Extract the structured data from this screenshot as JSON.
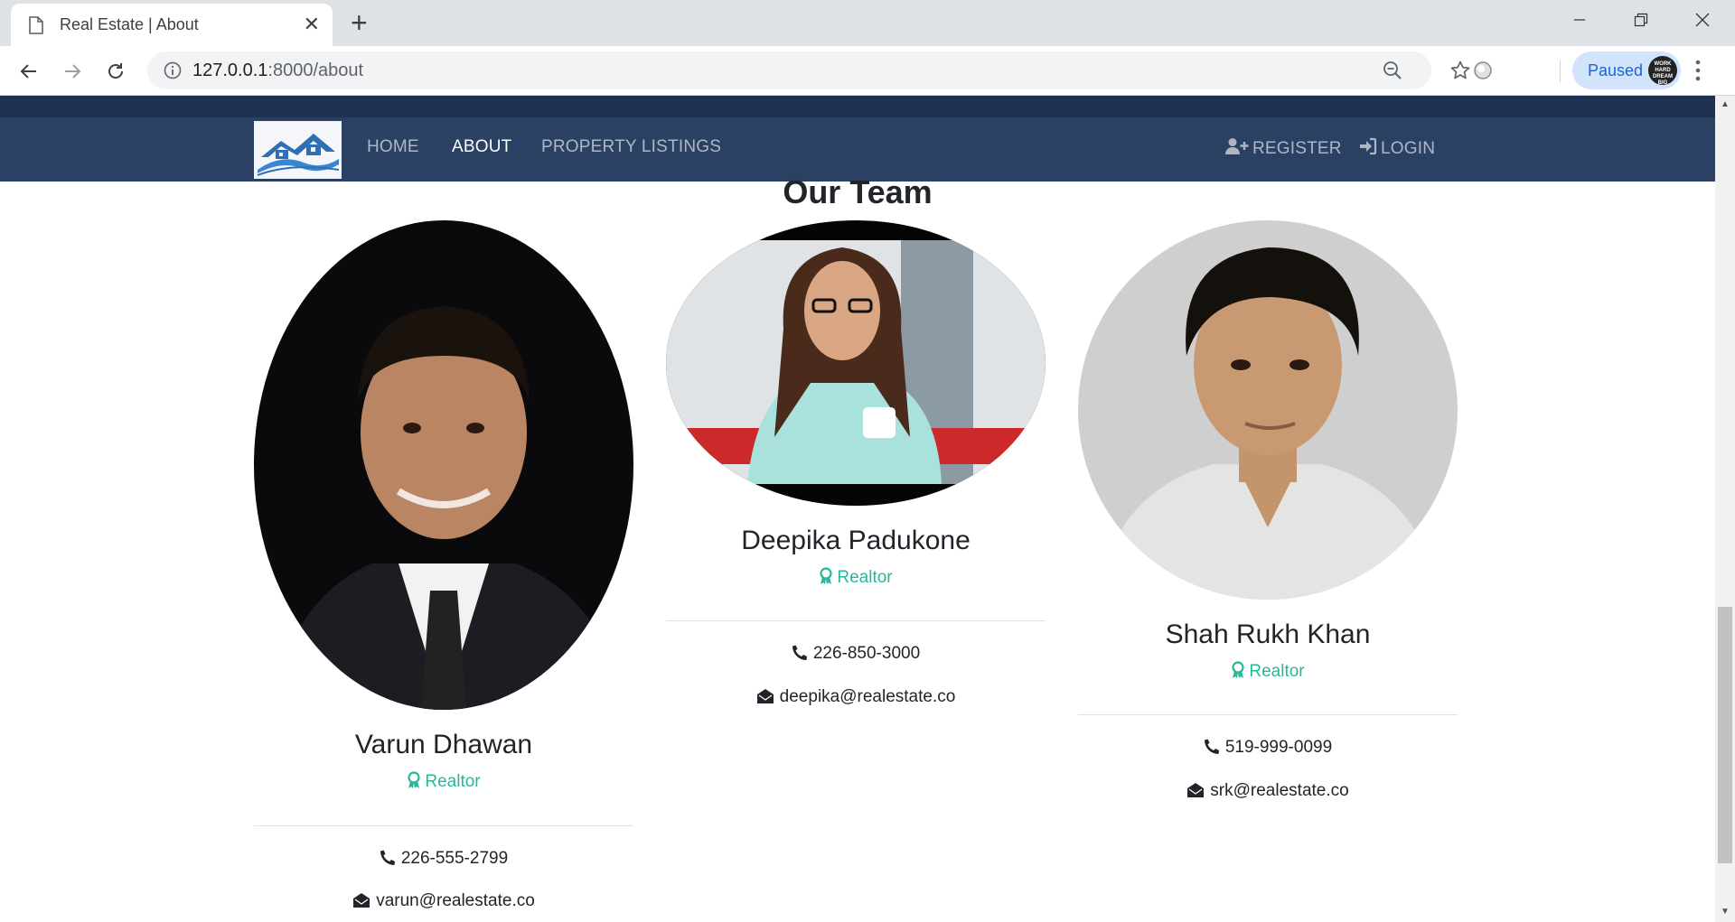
{
  "browser": {
    "tab_title": "Real Estate | About",
    "url_host": "127.0.0.1",
    "url_rest": ":8000/about",
    "profile_status": "Paused",
    "avatar_text": "WORK HARD DREAM BIG"
  },
  "nav": {
    "links": [
      "HOME",
      "ABOUT",
      "PROPERTY LISTINGS"
    ],
    "register": "REGISTER",
    "login": "LOGIN",
    "active": "ABOUT"
  },
  "section_title": "Our Team",
  "team": [
    {
      "name": "Varun Dhawan",
      "role": "Realtor",
      "phone": "226-555-2799",
      "email": "varun@realestate.co"
    },
    {
      "name": "Deepika Padukone",
      "role": "Realtor",
      "phone": "226-850-3000",
      "email": "deepika@realestate.co"
    },
    {
      "name": "Shah Rukh Khan",
      "role": "Realtor",
      "phone": "519-999-0099",
      "email": "srk@realestate.co"
    }
  ],
  "colors": {
    "navbar": "#2a4164",
    "accent": "#26b99a"
  }
}
